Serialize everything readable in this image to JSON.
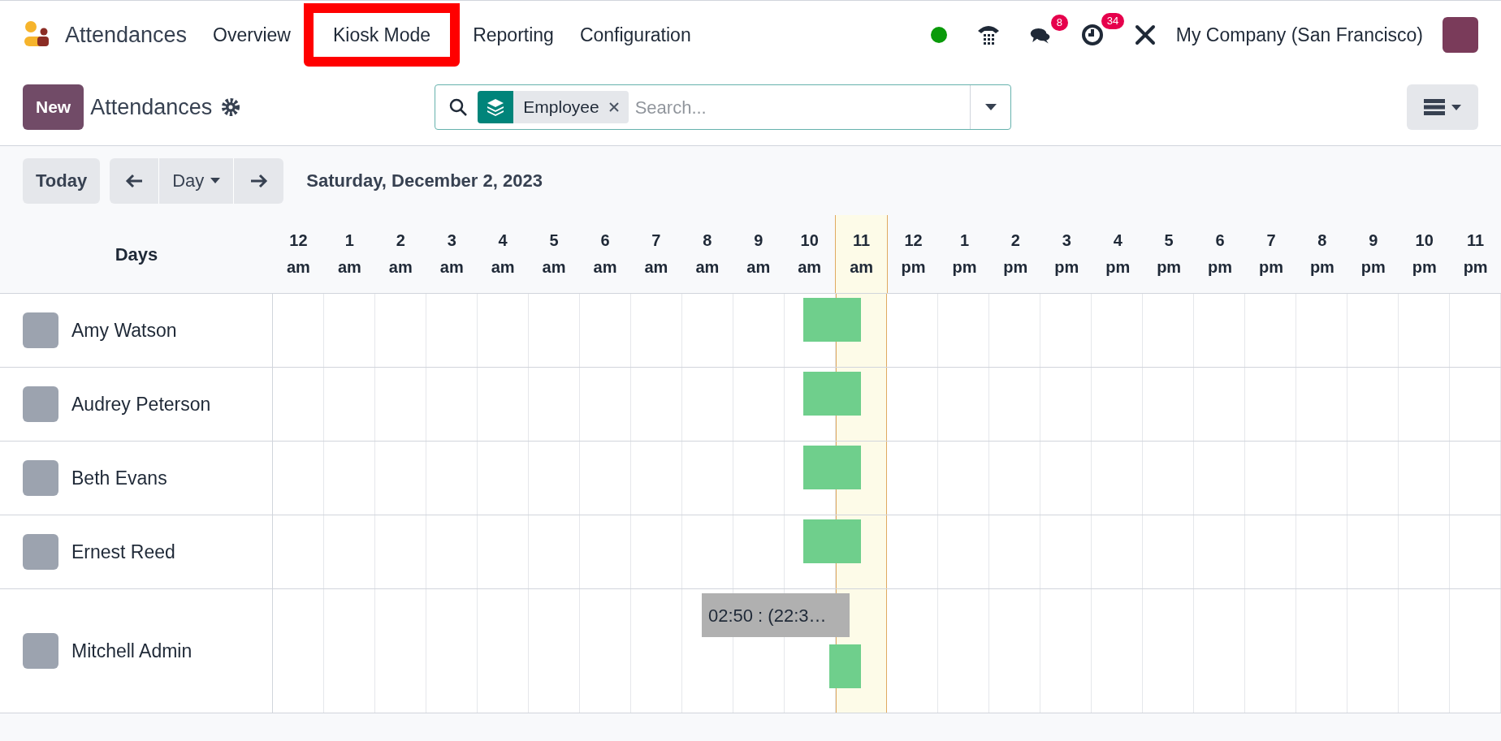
{
  "navbar": {
    "app_name": "Attendances",
    "menu": [
      {
        "label": "Overview",
        "highlighted": false
      },
      {
        "label": "Kiosk Mode",
        "highlighted": true
      },
      {
        "label": "Reporting",
        "highlighted": false
      },
      {
        "label": "Configuration",
        "highlighted": false
      }
    ],
    "online": true,
    "messages_badge": "8",
    "activities_badge": "34",
    "company": "My Company (San Francisco)"
  },
  "control_panel": {
    "new_button": "New",
    "title": "Attendances",
    "search": {
      "facet": "Employee",
      "placeholder": "Search..."
    }
  },
  "toolbar": {
    "today": "Today",
    "scale": "Day",
    "date": "Saturday, December 2, 2023"
  },
  "gantt": {
    "row_header": "Days",
    "hours": [
      {
        "hour": "12",
        "period": "am",
        "today": false
      },
      {
        "hour": "1",
        "period": "am",
        "today": false
      },
      {
        "hour": "2",
        "period": "am",
        "today": false
      },
      {
        "hour": "3",
        "period": "am",
        "today": false
      },
      {
        "hour": "4",
        "period": "am",
        "today": false
      },
      {
        "hour": "5",
        "period": "am",
        "today": false
      },
      {
        "hour": "6",
        "period": "am",
        "today": false
      },
      {
        "hour": "7",
        "period": "am",
        "today": false
      },
      {
        "hour": "8",
        "period": "am",
        "today": false
      },
      {
        "hour": "9",
        "period": "am",
        "today": false
      },
      {
        "hour": "10",
        "period": "am",
        "today": false
      },
      {
        "hour": "11",
        "period": "am",
        "today": true
      },
      {
        "hour": "12",
        "period": "pm",
        "today": false
      },
      {
        "hour": "1",
        "period": "pm",
        "today": false
      },
      {
        "hour": "2",
        "period": "pm",
        "today": false
      },
      {
        "hour": "3",
        "period": "pm",
        "today": false
      },
      {
        "hour": "4",
        "period": "pm",
        "today": false
      },
      {
        "hour": "5",
        "period": "pm",
        "today": false
      },
      {
        "hour": "6",
        "period": "pm",
        "today": false
      },
      {
        "hour": "7",
        "period": "pm",
        "today": false
      },
      {
        "hour": "8",
        "period": "pm",
        "today": false
      },
      {
        "hour": "9",
        "period": "pm",
        "today": false
      },
      {
        "hour": "10",
        "period": "pm",
        "today": false
      },
      {
        "hour": "11",
        "period": "pm",
        "today": false
      }
    ],
    "rows": [
      {
        "name": "Amy Watson",
        "lanes": [
          [
            {
              "kind": "attendance"
            }
          ]
        ]
      },
      {
        "name": "Audrey Peterson",
        "lanes": [
          [
            {
              "kind": "attendance"
            }
          ]
        ]
      },
      {
        "name": "Beth Evans",
        "lanes": [
          [
            {
              "kind": "attendance"
            }
          ]
        ]
      },
      {
        "name": "Ernest Reed",
        "lanes": [
          [
            {
              "kind": "attendance"
            }
          ]
        ]
      },
      {
        "name": "Mitchell Admin",
        "lanes": [
          [
            {
              "kind": "overtime",
              "label": "02:50 : (22:3…"
            }
          ],
          [
            {
              "kind": "attendance"
            }
          ]
        ]
      }
    ]
  }
}
